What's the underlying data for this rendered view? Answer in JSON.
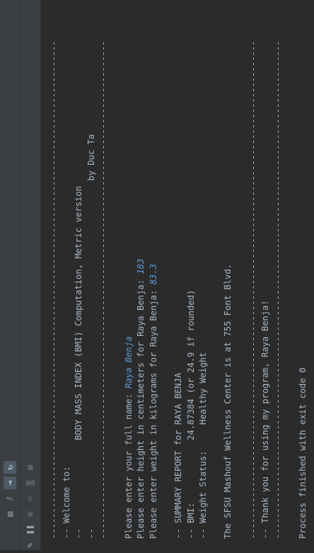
{
  "console": {
    "lines": [
      {
        "text": "------------------------------------------------------------------------------------------------"
      },
      {
        "text": "-- Welcome to:"
      },
      {
        "text": "--                 BODY MASS INDEX (BMI) Computation, Metric version"
      },
      {
        "text": "--                                                                   by Duc Ta"
      },
      {
        "text": "------------------------------------------------------------------------------------------------"
      },
      {
        "text": ""
      },
      {
        "text": "Please enter your full name: ",
        "input": "Raya Benja"
      },
      {
        "text": "Please enter height in centimeters for Raya Benja: ",
        "input": "183"
      },
      {
        "text": "Please enter weight in kilograms for Raya Benja: ",
        "input": "83.3"
      },
      {
        "text": ""
      },
      {
        "text": "-- SUMMARY REPORT for RAYA BENJA"
      },
      {
        "text": "-- BMI:            24.87384 (or 24.9 if rounded)"
      },
      {
        "text": "-- Weight Status:     Healthy Weight"
      },
      {
        "text": ""
      },
      {
        "text": "The SFSU Mashouf Wellness Center is at 755 Font Blvd."
      },
      {
        "text": ""
      },
      {
        "text": "------------------------------------------------------------------------------------------------"
      },
      {
        "text": "-- Thank you for using my program, Raya Benja!"
      },
      {
        "text": "------------------------------------------------------------------------------------------------"
      },
      {
        "text": ""
      },
      {
        "text": "Process finished with exit code 0"
      }
    ]
  },
  "toolbar": {
    "col1": [
      {
        "icon": "rerun-icon",
        "glyph": "↻",
        "active": true
      },
      {
        "icon": "scroll-to-end-icon",
        "glyph": "⇥",
        "active": true
      },
      {
        "icon": "soft-wrap-icon",
        "glyph": "⫽",
        "active": false
      },
      {
        "icon": "print-icon",
        "glyph": "▤",
        "active": false
      }
    ],
    "col2": [
      {
        "icon": "stop-icon",
        "glyph": "■",
        "dim": true
      },
      {
        "icon": "camera-icon",
        "glyph": "◙",
        "dim": true
      },
      {
        "icon": "exit-icon",
        "glyph": "⇄",
        "dim": true
      },
      {
        "icon": "restore-layout-icon",
        "glyph": "▣",
        "dim": true
      },
      {
        "icon": "pause-icon",
        "glyph": "❚❚",
        "dim": false
      },
      {
        "icon": "pin-icon",
        "glyph": "✎",
        "dim": false
      }
    ]
  }
}
